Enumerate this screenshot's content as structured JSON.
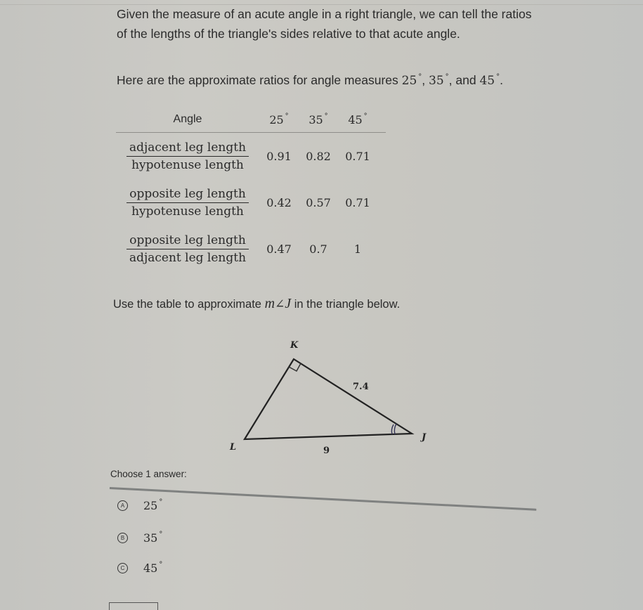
{
  "intro": {
    "line1": "Given the measure of an acute angle in a right triangle, we can tell the ratios",
    "line2": "of the lengths of the triangle's sides relative to that acute angle.",
    "ratios_prefix": "Here are the approximate ratios for angle measures",
    "angle_a": "25",
    "angle_b": "35",
    "angle_c": "45",
    "sep": ",",
    "and": ", and",
    "end": ".",
    "degree": "°"
  },
  "table": {
    "header": "Angle",
    "angles": [
      "25",
      "35",
      "45"
    ],
    "rows": [
      {
        "numerator": "adjacent leg length",
        "denominator": "hypotenuse length",
        "values": [
          "0.91",
          "0.82",
          "0.71"
        ]
      },
      {
        "numerator": "opposite leg length",
        "denominator": "hypotenuse length",
        "values": [
          "0.42",
          "0.57",
          "0.71"
        ]
      },
      {
        "numerator": "opposite leg length",
        "denominator": "adjacent leg length",
        "values": [
          "0.47",
          "0.7",
          "1"
        ]
      }
    ]
  },
  "question": {
    "prefix": "Use the table to approximate",
    "m": "m",
    "angle_symbol": "∠",
    "J": "J",
    "suffix": "in the triangle below."
  },
  "triangle": {
    "vertex_k": "K",
    "vertex_l": "L",
    "vertex_j": "J",
    "side_kj": "7.4",
    "side_lj": "9"
  },
  "answers": {
    "prompt": "Choose 1 answer:",
    "options": [
      {
        "letter": "A",
        "value": "25"
      },
      {
        "letter": "B",
        "value": "35"
      },
      {
        "letter": "C",
        "value": "45"
      }
    ],
    "degree": "°"
  }
}
